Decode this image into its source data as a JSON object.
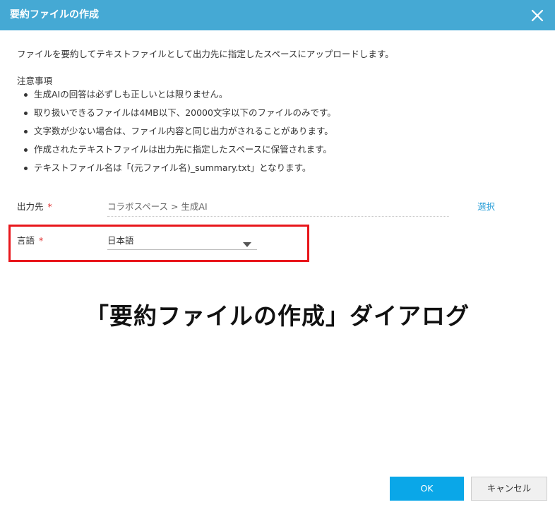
{
  "dialog": {
    "title": "要約ファイルの作成",
    "close_icon": "close-icon"
  },
  "description": "ファイルを要約してテキストファイルとして出力先に指定したスペースにアップロードします。",
  "notes": {
    "heading": "注意事項",
    "items": [
      "生成AIの回答は必ずしも正しいとは限りません。",
      "取り扱いできるファイルは4MB以下、20000文字以下のファイルのみです。",
      "文字数が少ない場合は、ファイル内容と同じ出力がされることがあります。",
      "作成されたテキストファイルは出力先に指定したスペースに保管されます。",
      "テキストファイル名は「(元ファイル名)_summary.txt」となります。"
    ]
  },
  "form": {
    "destination": {
      "label": "出力先",
      "required_mark": "*",
      "value": "コラボスペース > 生成AI",
      "select_label": "選択"
    },
    "language": {
      "label": "言語",
      "required_mark": "*",
      "value": "日本語",
      "arrow_icon": "caret-down-icon"
    }
  },
  "caption": "「要約ファイルの作成」ダイアログ",
  "buttons": {
    "ok": "OK",
    "cancel": "キャンセル"
  },
  "colors": {
    "titlebar": "#45a9d4",
    "ok_button": "#0aa7e8",
    "link": "#2a9fd8",
    "required": "#e03030",
    "highlight": "#e8161b"
  }
}
